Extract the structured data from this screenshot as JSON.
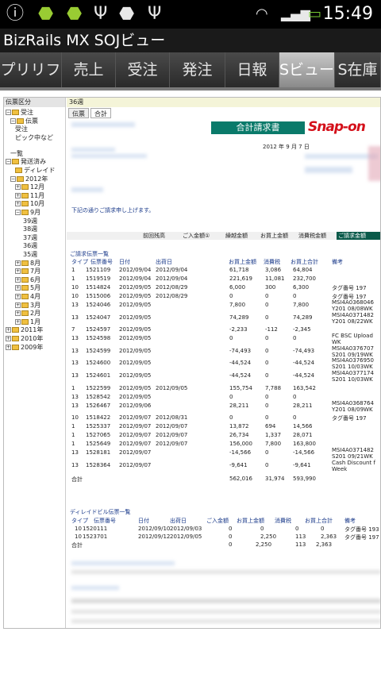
{
  "status": {
    "time": "15:49"
  },
  "app": {
    "title": "BizRails MX SOJビュー"
  },
  "tabs": [
    {
      "label": "プリリフ",
      "w": 78
    },
    {
      "label": "売上",
      "w": 66
    },
    {
      "label": "発注",
      "w": 0
    },
    {
      "label": "受注",
      "w": 70
    },
    {
      "label": "日報",
      "w": 70
    },
    {
      "label": "Sビュー",
      "w": 70
    },
    {
      "label": "S在庫",
      "w": 60
    }
  ],
  "tree": {
    "header": "伝票区分",
    "nodes": [
      {
        "label": "受注"
      },
      {
        "label": "伝票"
      },
      {
        "label": "受注"
      },
      {
        "label": "ピック中など"
      },
      {
        "label": "一覧"
      },
      {
        "label": "発送済み"
      },
      {
        "label": "ディレイド"
      },
      {
        "label": "2012年"
      },
      {
        "label": "12月"
      },
      {
        "label": "11月"
      },
      {
        "label": "10月"
      },
      {
        "label": "9月"
      },
      {
        "label": "39週"
      },
      {
        "label": "38週"
      },
      {
        "label": "37週"
      },
      {
        "label": "36週"
      },
      {
        "label": "35週"
      },
      {
        "label": "8月"
      },
      {
        "label": "7月"
      },
      {
        "label": "6月"
      },
      {
        "label": "5月"
      },
      {
        "label": "4月"
      },
      {
        "label": "3月"
      },
      {
        "label": "2月"
      },
      {
        "label": "1月"
      },
      {
        "label": "2011年"
      },
      {
        "label": "2010年"
      },
      {
        "label": "2009年"
      }
    ]
  },
  "doc": {
    "week": "36週",
    "subtabs": [
      "伝票",
      "合計"
    ],
    "title": "合計請求書",
    "brand": "Snap-on",
    "date": "2012 年 9 月 7 日",
    "greeting": "下記の通りご請求申し上げます。",
    "summary_headers": [
      "前回残高",
      "ご入金額①",
      "繰越金額",
      "お買上金額",
      "消費税金額",
      "ご請求金額"
    ],
    "section1": "ご請求伝票一覧",
    "cols": [
      "タイプ",
      "伝票番号",
      "日付",
      "出荷日",
      "",
      "お買上金額",
      "消費税",
      "お買上合計",
      "備考"
    ],
    "rows": [
      [
        "1",
        "1521109",
        "2012/09/04",
        "2012/09/04",
        "61,718",
        "3,086",
        "64,804",
        ""
      ],
      [
        "1",
        "1519519",
        "2012/09/04",
        "2012/09/04",
        "221,619",
        "11,081",
        "232,700",
        ""
      ],
      [
        "10",
        "1514824",
        "2012/09/05",
        "2012/08/29",
        "6,000",
        "300",
        "6,300",
        "タグ番号 197"
      ],
      [
        "10",
        "1515006",
        "2012/09/05",
        "2012/08/29",
        "0",
        "0",
        "0",
        "タグ番号 197"
      ],
      [
        "13",
        "1524046",
        "2012/09/05",
        "",
        "7,800",
        "0",
        "7,800",
        "MSI4A0368046 Y201 08/08WK"
      ],
      [
        "13",
        "1524047",
        "2012/09/05",
        "",
        "74,289",
        "0",
        "74,289",
        "MSI4A0371482 Y201 08/22WK"
      ],
      [
        "7",
        "1524597",
        "2012/09/05",
        "",
        "-2,233",
        "-112",
        "-2,345",
        ""
      ],
      [
        "13",
        "1524598",
        "2012/09/05",
        "",
        "0",
        "0",
        "0",
        "FC BSC Upload WK"
      ],
      [
        "13",
        "1524599",
        "2012/09/05",
        "",
        "-74,493",
        "0",
        "-74,493",
        "MSI4A0376707 S201 09/19WK"
      ],
      [
        "13",
        "1524600",
        "2012/09/05",
        "",
        "-44,524",
        "0",
        "-44,524",
        "MSI4A0376950 S201 10/03WK"
      ],
      [
        "13",
        "1524601",
        "2012/09/05",
        "",
        "-44,524",
        "0",
        "-44,524",
        "MSI4A0377174 S201 10/03WK"
      ],
      [
        "1",
        "1522599",
        "2012/09/05",
        "2012/09/05",
        "155,754",
        "7,788",
        "163,542",
        ""
      ],
      [
        "13",
        "1528542",
        "2012/09/05",
        "",
        "0",
        "0",
        "0",
        ""
      ],
      [
        "13",
        "1526467",
        "2012/09/06",
        "",
        "28,211",
        "0",
        "28,211",
        "MSI4A0368764 Y201 08/09WK"
      ],
      [
        "10",
        "1518422",
        "2012/09/07",
        "2012/08/31",
        "0",
        "0",
        "0",
        "タグ番号 197"
      ],
      [
        "1",
        "1525337",
        "2012/09/07",
        "2012/09/07",
        "13,872",
        "694",
        "14,566",
        ""
      ],
      [
        "1",
        "1527065",
        "2012/09/07",
        "2012/09/07",
        "26,734",
        "1,337",
        "28,071",
        ""
      ],
      [
        "1",
        "1525649",
        "2012/09/07",
        "2012/09/07",
        "156,000",
        "7,800",
        "163,800",
        ""
      ],
      [
        "13",
        "1528181",
        "2012/09/07",
        "",
        "-14,566",
        "0",
        "-14,566",
        "MSI4A0371482 S201 09/21WK"
      ],
      [
        "13",
        "1528364",
        "2012/09/07",
        "",
        "-9,641",
        "0",
        "-9,641",
        "Cash Discount f Week"
      ]
    ],
    "total1": {
      "label": "合計",
      "amount": "562,016",
      "tax": "31,974",
      "sum": "593,990"
    },
    "section2": "ディレイドビル伝票一覧",
    "cols2": [
      "タイプ",
      "伝票番号",
      "日付",
      "出荷日",
      "ご入金額",
      "お買上金額",
      "消費税",
      "お買上合計",
      "備考"
    ],
    "rows2": [
      [
        "10",
        "1520111",
        "2012/09/10",
        "2012/09/03",
        "0",
        "0",
        "0",
        "0",
        "タグ番号 193"
      ],
      [
        "10",
        "1523701",
        "2012/09/12",
        "2012/09/05",
        "0",
        "2,250",
        "113",
        "2,363",
        "タグ番号 197"
      ]
    ],
    "total2": {
      "label": "合計",
      "nyukin": "0",
      "amount": "2,250",
      "tax": "113",
      "sum": "2,363"
    }
  }
}
